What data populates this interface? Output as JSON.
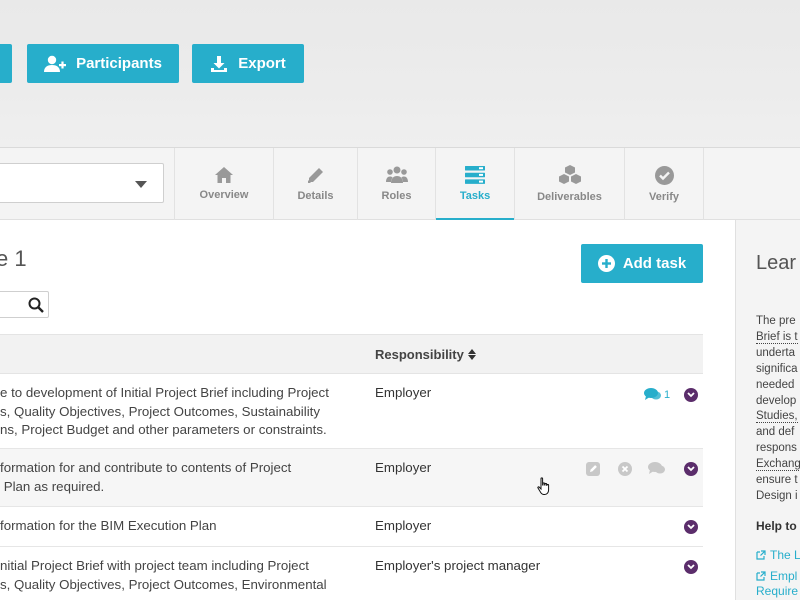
{
  "header": {
    "buttons": [
      {
        "label": "Participants",
        "icon": "add-user-icon"
      },
      {
        "label": "Export",
        "icon": "download-icon"
      }
    ]
  },
  "tabs": [
    {
      "label": "Overview",
      "icon": "home-icon",
      "active": false
    },
    {
      "label": "Details",
      "icon": "pencil-icon",
      "active": false
    },
    {
      "label": "Roles",
      "icon": "users-icon",
      "active": false
    },
    {
      "label": "Tasks",
      "icon": "tasks-icon",
      "active": true
    },
    {
      "label": "Deliverables",
      "icon": "cubes-icon",
      "active": false
    },
    {
      "label": "Verify",
      "icon": "check-circle-icon",
      "active": false
    }
  ],
  "main": {
    "title": "e 1",
    "add_task_label": "Add task",
    "table": {
      "responsibility_header": "Responsibility",
      "rows": [
        {
          "task": "e to development of Initial Project Brief including Project\ns, Quality Objectives, Project Outcomes, Sustainability\nns, Project Budget and other parameters or constraints.",
          "responsibility": "Employer",
          "comment_count": "1"
        },
        {
          "task": "formation for and contribute to contents of Project\n Plan as required.",
          "responsibility": "Employer"
        },
        {
          "task": "formation for the BIM Execution Plan",
          "responsibility": "Employer"
        },
        {
          "task": "nitial Project Brief with project team including Project\ns, Quality Objectives, Project Outcomes, Environmental",
          "responsibility": "Employer's project manager"
        }
      ]
    }
  },
  "sidebar": {
    "title": "Lear",
    "body_lines": [
      "The pre",
      "Brief is t",
      "underta",
      "significa",
      "needed",
      "develop",
      "Studies,",
      "and def",
      "respons",
      "Exchang",
      "ensure t",
      "Design i"
    ],
    "help_title": "Help to",
    "links": [
      "The L",
      "Empl"
    ],
    "link_continuation": "Require"
  },
  "colors": {
    "accent": "#27aecb",
    "chevron": "#5b2d6b"
  }
}
